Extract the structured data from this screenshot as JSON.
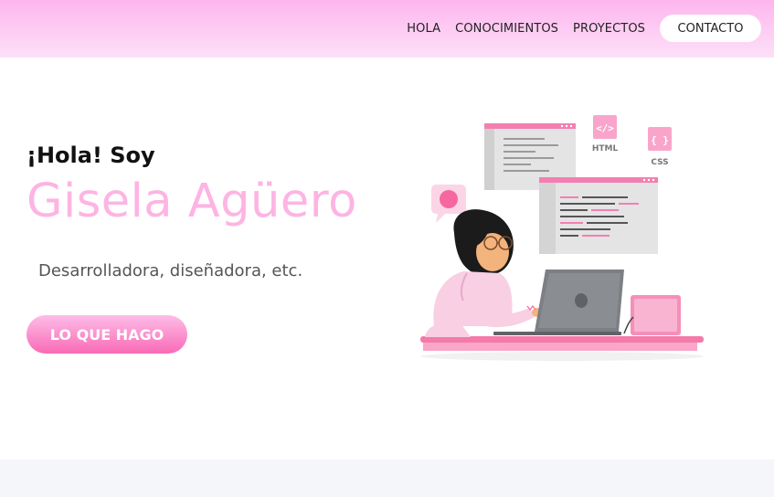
{
  "nav": {
    "links": [
      "HOLA",
      "CONOCIMIENTOS",
      "PROYECTOS"
    ],
    "cta": "CONTACTO"
  },
  "hero": {
    "greeting": "¡Hola! Soy",
    "name": "Gisela Agüero",
    "subtitle": "Desarrolladora, diseñadora, etc.",
    "button": "LO QUE HAGO"
  },
  "illustration": {
    "html_label": "HTML",
    "html_icon": "</>",
    "css_label": "CSS",
    "css_icon": "{ }",
    "icon": "developer-at-laptop-illustration"
  },
  "colors": {
    "accent": "#fdb4e3",
    "button_bottom": "#f96ab5",
    "nav_top": "#fdb6ee"
  }
}
